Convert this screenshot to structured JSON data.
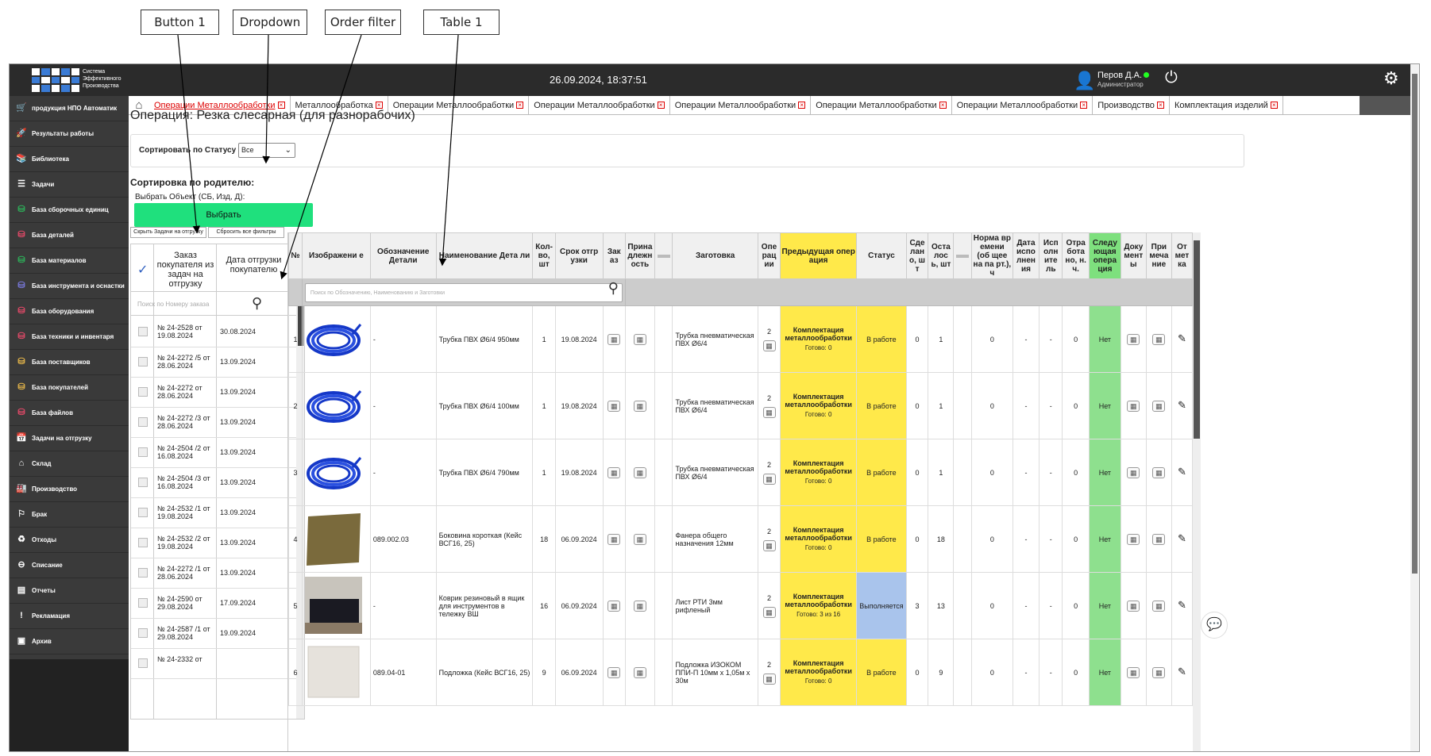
{
  "callouts": {
    "button1": "Button 1",
    "dropdown": "Dropdown",
    "order_filter": "Order filter",
    "table1": "Table 1"
  },
  "header": {
    "logo_text": [
      "Система",
      "Эффективного",
      "Производства"
    ],
    "datetime": "26.09.2024, 18:37:51",
    "user_name": "Перов Д.А.",
    "user_role": "Администратор",
    "user_icon": "user-icon",
    "power_icon": "power-icon",
    "settings_icon": "gear-icon"
  },
  "sidebar": {
    "items": [
      {
        "label": "продукция НПО Автоматик",
        "icon": "cart-icon"
      },
      {
        "label": "Результаты работы",
        "icon": "rocket-icon"
      },
      {
        "label": "Библиотека",
        "icon": "books-icon"
      },
      {
        "label": "Задачи",
        "icon": "tasks-icon"
      },
      {
        "label": "База сборочных единиц",
        "icon": "database-icon"
      },
      {
        "label": "База деталей",
        "icon": "database-icon"
      },
      {
        "label": "База материалов",
        "icon": "database-icon"
      },
      {
        "label": "База инструмента и оснастки",
        "icon": "database-icon"
      },
      {
        "label": "База оборудования",
        "icon": "database-icon"
      },
      {
        "label": "База техники и инвентаря",
        "icon": "database-icon"
      },
      {
        "label": "База поставщиков",
        "icon": "database-icon"
      },
      {
        "label": "База покупателей",
        "icon": "database-icon"
      },
      {
        "label": "База файлов",
        "icon": "database-icon"
      },
      {
        "label": "Задачи на отгрузку",
        "icon": "calendar-icon"
      },
      {
        "label": "Склад",
        "icon": "warehouse-icon"
      },
      {
        "label": "Производство",
        "icon": "factory-icon"
      },
      {
        "label": "Брак",
        "icon": "defect-icon"
      },
      {
        "label": "Отходы",
        "icon": "recycle-icon"
      },
      {
        "label": "Списание",
        "icon": "minus-circle-icon"
      },
      {
        "label": "Отчеты",
        "icon": "report-icon"
      },
      {
        "label": "Рекламация",
        "icon": "complaint-icon"
      },
      {
        "label": "Архив",
        "icon": "archive-icon"
      }
    ]
  },
  "tabs": [
    "Операции Металлообработки",
    "Металлообработка",
    "Операции Металлообработки",
    "Операции Металлообработки",
    "Операции Металлообработки",
    "Операции Металлообработки",
    "Операции Металлообработки",
    "Производство",
    "Комплектация изделий"
  ],
  "page": {
    "title": "Операция: Резка слесарная (для разнорабочих)",
    "sort_status_label": "Сортировать по Статусу",
    "sort_status_value": "Все",
    "parent_sort_label": "Сортировка по родителю:",
    "choose_object_label": "Выбрать Объект (СБ, Изд, Д):",
    "choose_button": "Выбрать",
    "hide_button": "Скрыть Задачи на отгрузку",
    "reset_button": "Сбросить все фильтры"
  },
  "orders": {
    "col1": "Заказ покупателя из задач на отгрузку",
    "col2": "Дата отгрузки покупателю",
    "search_placeholder": "Поиск по Номеру заказа",
    "rows": [
      {
        "order": "№ 24-2528 от 19.08.2024",
        "date": "30.08.2024"
      },
      {
        "order": "№ 24-2272 /5 от 28.06.2024",
        "date": "13.09.2024"
      },
      {
        "order": "№ 24-2272 от 28.06.2024",
        "date": "13.09.2024"
      },
      {
        "order": "№ 24-2272 /3 от 28.06.2024",
        "date": "13.09.2024"
      },
      {
        "order": "№ 24-2504 /2 от 16.08.2024",
        "date": "13.09.2024"
      },
      {
        "order": "№ 24-2504 /3 от 16.08.2024",
        "date": "13.09.2024"
      },
      {
        "order": "№ 24-2532 /1 от 19.08.2024",
        "date": "13.09.2024"
      },
      {
        "order": "№ 24-2532 /2 от 19.08.2024",
        "date": "13.09.2024"
      },
      {
        "order": "№ 24-2272 /1 от 28.06.2024",
        "date": "13.09.2024"
      },
      {
        "order": "№ 24-2590 от 29.08.2024",
        "date": "17.09.2024"
      },
      {
        "order": "№ 24-2587 /1 от 29.08.2024",
        "date": "19.09.2024"
      },
      {
        "order": "№ 24-2332 от",
        "date": ""
      }
    ]
  },
  "table": {
    "headers": [
      "№",
      "Изображени е",
      "Обозначение Детали",
      "Наименование Дета ли",
      "Кол-во, шт",
      "Срок отгр узки",
      "Зак аз",
      "Прина длежн ость",
      "",
      "Заготовка",
      "Опе рац ии",
      "Предыдущая опер ация",
      "Статус",
      "Сде лан о, ш т",
      "Оста лос ь, шт",
      "",
      "Норма вр емени (об щее на па рт.), ч",
      "Дата испо лнен ия",
      "Исп олн ите ль",
      "Отра бота но, н. ч.",
      "Следу ющая опера ция",
      "Доку мент ы",
      "При меча ние",
      "От мет ка"
    ],
    "search_placeholder": "Поиск по Обозначению, Наименованию и Заготовки",
    "rows": [
      {
        "n": "1",
        "image": "blue-tube",
        "code": "-",
        "name": "Трубка ПВХ Ø6/4 950мм",
        "qty": "1",
        "due": "19.08.2024",
        "blank": "Трубка пневматическая ПВХ Ø6/4",
        "ops": "2",
        "prev": "Комплектация металлообработки",
        "ready": "Готово: 0",
        "status": "В работе",
        "status_color": "#ffe94a",
        "done": "0",
        "left": "1",
        "norm": "0",
        "date": "-",
        "exec": "-",
        "worked": "0",
        "next": "Нет"
      },
      {
        "n": "2",
        "image": "blue-tube",
        "code": "-",
        "name": "Трубка ПВХ Ø6/4 100мм",
        "qty": "1",
        "due": "19.08.2024",
        "blank": "Трубка пневматическая ПВХ Ø6/4",
        "ops": "2",
        "prev": "Комплектация металлообработки",
        "ready": "Готово: 0",
        "status": "В работе",
        "status_color": "#ffe94a",
        "done": "0",
        "left": "1",
        "norm": "0",
        "date": "-",
        "exec": "-",
        "worked": "0",
        "next": "Нет"
      },
      {
        "n": "3",
        "image": "blue-tube",
        "code": "-",
        "name": "Трубка ПВХ Ø6/4 790мм",
        "qty": "1",
        "due": "19.08.2024",
        "blank": "Трубка пневматическая ПВХ Ø6/4",
        "ops": "2",
        "prev": "Комплектация металлообработки",
        "ready": "Готово: 0",
        "status": "В работе",
        "status_color": "#ffe94a",
        "done": "0",
        "left": "1",
        "norm": "0",
        "date": "-",
        "exec": "-",
        "worked": "0",
        "next": "Нет"
      },
      {
        "n": "4",
        "image": "plywood",
        "code": "089.002.03",
        "name": "Боковина короткая (Кейс ВСГ16, 25)",
        "qty": "18",
        "due": "06.09.2024",
        "blank": "Фанера общего назначения 12мм",
        "ops": "2",
        "prev": "Комплектация металлообработки",
        "ready": "Готово: 0",
        "status": "В работе",
        "status_color": "#ffe94a",
        "done": "0",
        "left": "18",
        "norm": "0",
        "date": "-",
        "exec": "-",
        "worked": "0",
        "next": "Нет"
      },
      {
        "n": "5",
        "image": "rubber-mat",
        "code": "-",
        "name": "Коврик резиновый в ящик для инструментов в тележку ВШ",
        "qty": "16",
        "due": "06.09.2024",
        "blank": "Лист РТИ 3мм рифленый",
        "ops": "2",
        "prev": "Комплектация металлообработки",
        "ready": "Готово: 3 из 16",
        "status": "Выполняется",
        "status_color": "#a9c4ec",
        "done": "3",
        "left": "13",
        "norm": "0",
        "date": "-",
        "exec": "-",
        "worked": "0",
        "next": "Нет"
      },
      {
        "n": "6",
        "image": "foam-pad",
        "code": "089.04-01",
        "name": "Подложка (Кейс ВСГ16, 25)",
        "qty": "9",
        "due": "06.09.2024",
        "blank": "Подложка ИЗОКОМ ППИ-П 10мм х 1,05м х 30м",
        "ops": "2",
        "prev": "Комплектация металлообработки",
        "ready": "Готово: 0",
        "status": "В работе",
        "status_color": "#ffe94a",
        "done": "0",
        "left": "9",
        "norm": "0",
        "date": "-",
        "exec": "-",
        "worked": "0",
        "next": "Нет"
      }
    ]
  },
  "colors": {
    "accent_green": "#1fe07d",
    "prev_op_yellow": "#ffe94a",
    "next_op_green": "#8ee08e",
    "in_progress_blue": "#a9c4ec"
  }
}
